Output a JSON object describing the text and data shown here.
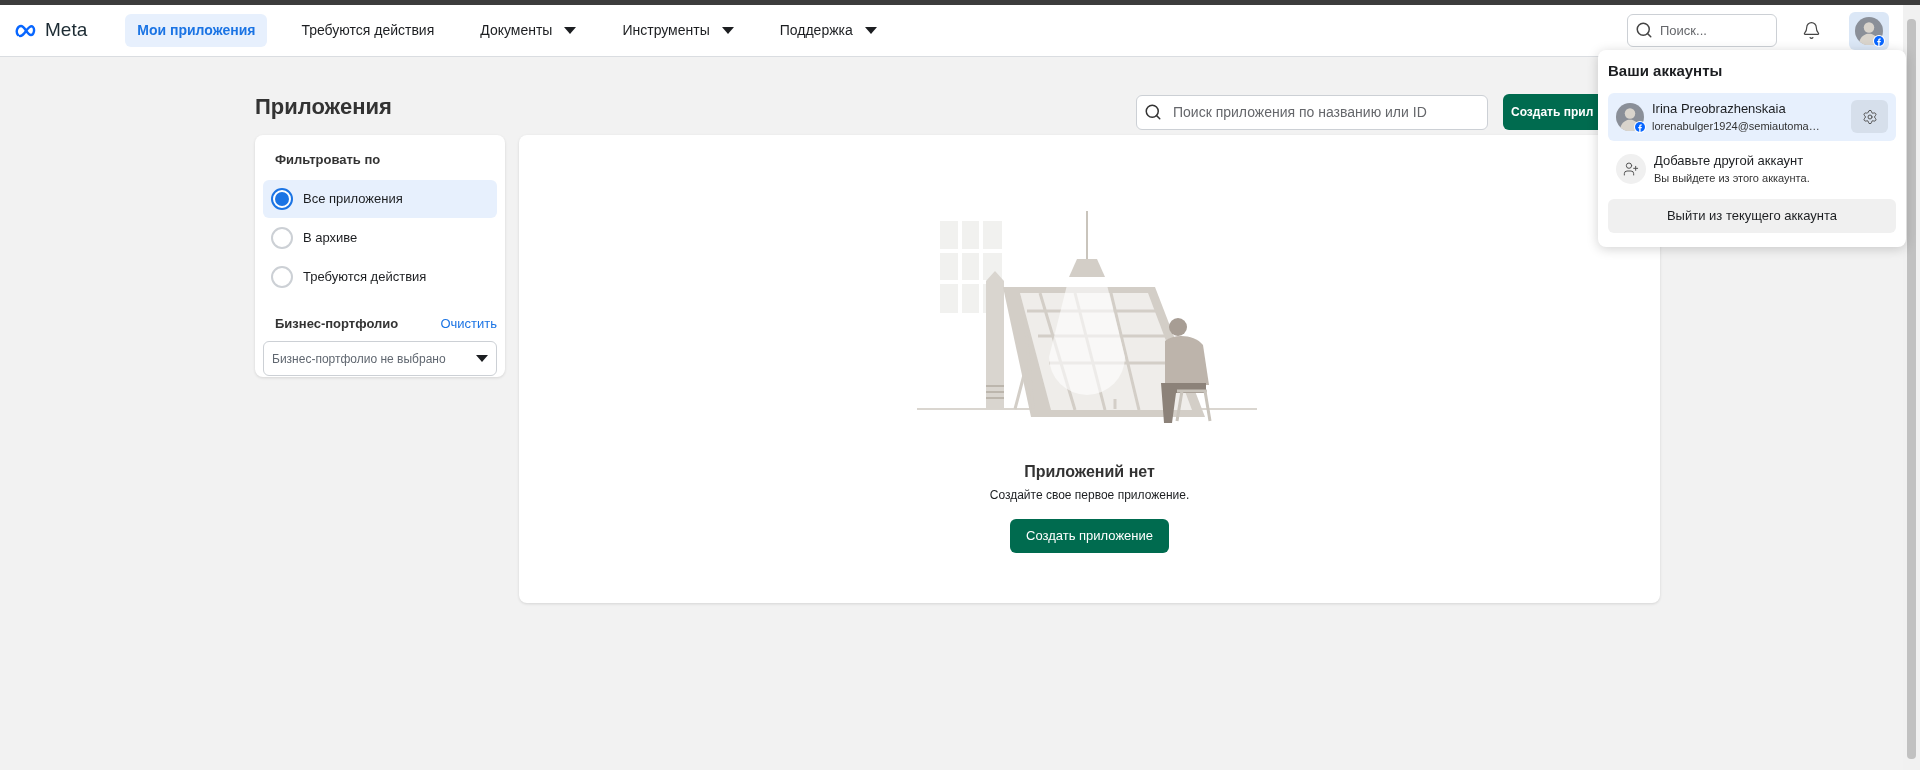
{
  "nav": {
    "logo": "Meta",
    "items": [
      {
        "label": "Мои приложения",
        "selected": true,
        "dropdown": false
      },
      {
        "label": "Требуются действия",
        "selected": false,
        "dropdown": false
      },
      {
        "label": "Документы",
        "selected": false,
        "dropdown": true
      },
      {
        "label": "Инструменты",
        "selected": false,
        "dropdown": true
      },
      {
        "label": "Поддержка",
        "selected": false,
        "dropdown": true
      }
    ],
    "search": {
      "placeholder": "Поиск..."
    }
  },
  "page": {
    "title": "Приложения",
    "search": {
      "placeholder": "Поиск приложения по названию или ID"
    },
    "create_button": "Создать прил"
  },
  "filters": {
    "heading": "Фильтровать по",
    "options": [
      {
        "label": "Все приложения",
        "selected": true
      },
      {
        "label": "В архиве",
        "selected": false
      },
      {
        "label": "Требуются действия",
        "selected": false
      }
    ],
    "portfolio": {
      "label": "Бизнес-портфолио",
      "clear": "Очистить",
      "value": "Бизнес-портфолио не выбрано"
    }
  },
  "empty_state": {
    "title": "Приложений нет",
    "subtitle": "Создайте свое первое приложение.",
    "button": "Создать приложение"
  },
  "account_menu": {
    "title": "Ваши аккаунты",
    "accounts": [
      {
        "name": "Irina Preobrazhenskaia",
        "email": "lorenabulger1924@semiautoma…",
        "selected": true
      }
    ],
    "add_account": {
      "title": "Добавьте другой аккаунт",
      "subtitle": "Вы выйдете из этого аккаунта."
    },
    "logout": "Выйти из текущего аккаунта"
  }
}
